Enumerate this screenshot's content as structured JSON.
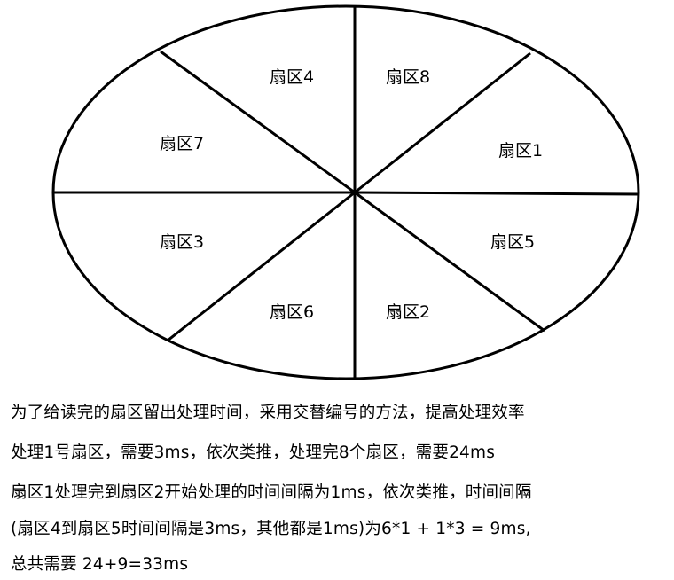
{
  "diagram": {
    "sectors": [
      {
        "id": "sector-4",
        "label": "扇区4"
      },
      {
        "id": "sector-8",
        "label": "扇区8"
      },
      {
        "id": "sector-7",
        "label": "扇区7"
      },
      {
        "id": "sector-1",
        "label": "扇区1"
      },
      {
        "id": "sector-3",
        "label": "扇区3"
      },
      {
        "id": "sector-5",
        "label": "扇区5"
      },
      {
        "id": "sector-6",
        "label": "扇区6"
      },
      {
        "id": "sector-2",
        "label": "扇区2"
      }
    ]
  },
  "explanation": {
    "lines": [
      "为了给读完的扇区留出处理时间，采用交替编号的方法，提高处理效率",
      "处理1号扇区，需要3ms，依次类推，处理完8个扇区，需要24ms",
      "扇区1处理完到扇区2开始处理的时间间隔为1ms，依次类推，时间间隔",
      "(扇区4到扇区5时间间隔是3ms，其他都是1ms)为6*1 + 1*3 = 9ms,",
      "总共需要 24+9=33ms"
    ]
  },
  "colors": {
    "stroke": "#000000",
    "background": "#ffffff"
  }
}
